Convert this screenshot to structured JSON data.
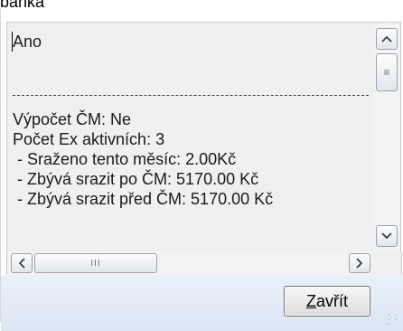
{
  "window": {
    "title_fragment": "banka"
  },
  "memo": {
    "lines": [
      "Ano",
      "-----------------------------------------------",
      "Výpočet ČM: Ne",
      "Počet Ex aktivních: 3",
      " - Sraženo tento měsíc: 2.00Kč",
      " - Zbývá srazit po ČM: 5170.00 Kč",
      " - Zbývá srazit před ČM: 5170.00 Kč"
    ]
  },
  "scrollbars": {
    "vertical": {
      "up_icon": "scroll-up-arrow",
      "down_icon": "scroll-down-arrow",
      "position_fraction": 0.0
    },
    "horizontal": {
      "left_icon": "scroll-left-arrow",
      "right_icon": "scroll-right-arrow",
      "position_fraction": 0.0
    }
  },
  "footer": {
    "close_label_first": "Z",
    "close_label_rest": "avřít"
  }
}
